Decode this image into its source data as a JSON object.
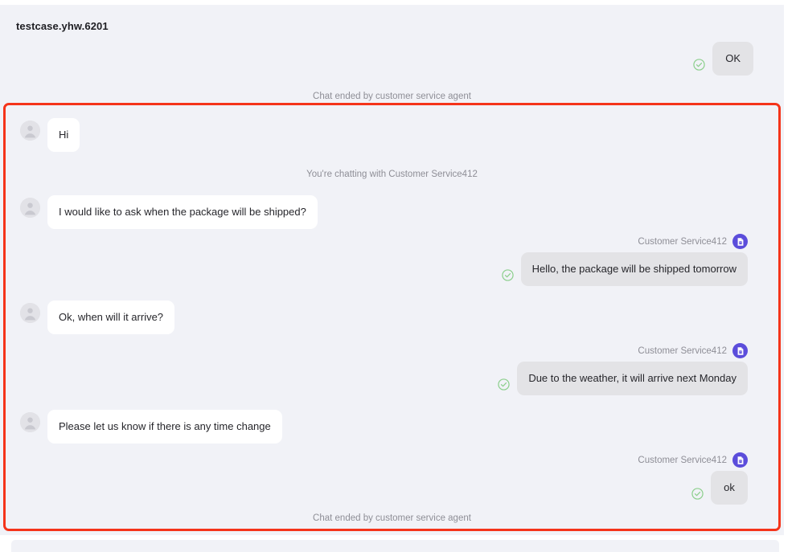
{
  "window": {
    "title": "testcase.yhw.6201"
  },
  "colors": {
    "panel_background": "#f1f2f7",
    "highlight_border": "#f5341a",
    "agent_avatar": "#5b4ddb",
    "agent_bubble": "#e3e3e6",
    "user_bubble": "#ffffff",
    "check_green": "#7ec87e",
    "muted_text": "#8e8e96"
  },
  "icons": {
    "user_avatar": "person-avatar-icon",
    "agent_avatar": "agent-badge-icon",
    "delivered_check": "check-circle-icon"
  },
  "pre_thread": {
    "messages": [
      {
        "sender": "agent",
        "text": "OK",
        "status_icon": "check-circle-icon"
      }
    ],
    "divider": "Chat ended by customer service agent"
  },
  "thread": {
    "agent_name": "Customer Service412",
    "dividers": {
      "chatting_with": "You're chatting with Customer Service412",
      "chat_ended": "Chat ended by customer service agent"
    },
    "messages": [
      {
        "id": 1,
        "sender": "user",
        "text": "Hi"
      },
      {
        "id": 2,
        "sender": "user",
        "text": "I would like  to ask when the package will be shipped?"
      },
      {
        "id": 3,
        "sender": "agent",
        "name": "Customer Service412",
        "text": "Hello, the package will be shipped tomorrow",
        "status_icon": "check-circle-icon"
      },
      {
        "id": 4,
        "sender": "user",
        "text": "Ok, when will it arrive?"
      },
      {
        "id": 5,
        "sender": "agent",
        "name": "Customer Service412",
        "text": "Due to the weather, it will arrive next Monday",
        "status_icon": "check-circle-icon"
      },
      {
        "id": 6,
        "sender": "user",
        "text": "Please let us know if there is any time change"
      },
      {
        "id": 7,
        "sender": "agent",
        "name": "Customer Service412",
        "text": "ok",
        "status_icon": "check-circle-icon"
      }
    ]
  }
}
